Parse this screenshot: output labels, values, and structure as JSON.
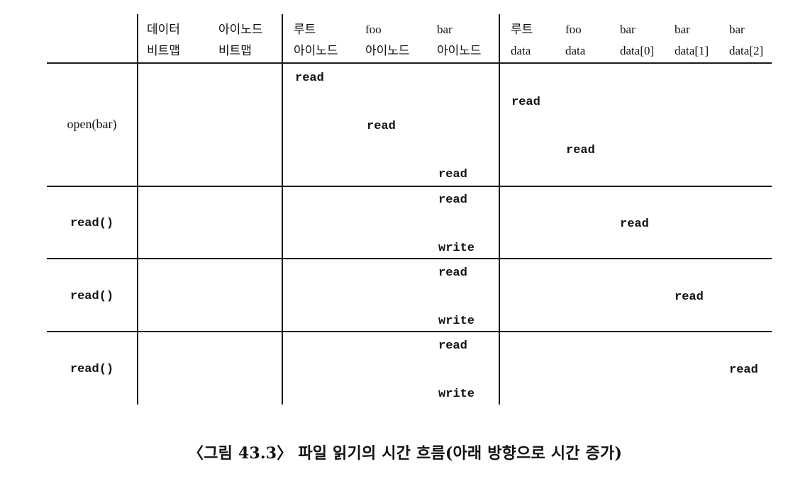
{
  "figure": {
    "caption": "〈그림 43.3〉 파일 읽기의 시간 흐름(아래 방향으로 시간 증가)"
  },
  "table": {
    "column_groups": [
      {
        "name": "operation",
        "columns": []
      },
      {
        "name": "bitmaps",
        "columns": [
          {
            "id": "data_bitmap",
            "line1": "데이터",
            "line2": "비트맵"
          },
          {
            "id": "inode_bitmap",
            "line1": "아이노드",
            "line2": "비트맵"
          }
        ]
      },
      {
        "name": "inodes",
        "columns": [
          {
            "id": "root_inode",
            "line1": "루트",
            "line2": "아이노드"
          },
          {
            "id": "foo_inode",
            "line1": "foo",
            "line2": "아이노드"
          },
          {
            "id": "bar_inode",
            "line1": "bar",
            "line2": "아이노드"
          }
        ]
      },
      {
        "name": "data_blocks",
        "columns": [
          {
            "id": "root_data",
            "line1": "루트",
            "line2": "data"
          },
          {
            "id": "foo_data",
            "line1": "foo",
            "line2": "data"
          },
          {
            "id": "bar_data0",
            "line1": "bar",
            "line2": "data[0]"
          },
          {
            "id": "bar_data1",
            "line1": "bar",
            "line2": "data[1]"
          },
          {
            "id": "bar_data2",
            "line1": "bar",
            "line2": "data[2]"
          }
        ]
      }
    ],
    "rows": [
      {
        "id": "row-open-bar",
        "label": "open(bar)",
        "label_style": "serif",
        "operations": [
          {
            "column": "root_inode",
            "op": "read"
          },
          {
            "column": "root_data",
            "op": "read"
          },
          {
            "column": "foo_inode",
            "op": "read"
          },
          {
            "column": "foo_data",
            "op": "read"
          },
          {
            "column": "bar_inode",
            "op": "read"
          }
        ]
      },
      {
        "id": "row-read-1",
        "label": "read()",
        "label_style": "mono",
        "operations": [
          {
            "column": "bar_inode",
            "op": "read"
          },
          {
            "column": "bar_data0",
            "op": "read"
          },
          {
            "column": "bar_inode",
            "op": "write"
          }
        ]
      },
      {
        "id": "row-read-2",
        "label": "read()",
        "label_style": "mono",
        "operations": [
          {
            "column": "bar_inode",
            "op": "read"
          },
          {
            "column": "bar_data1",
            "op": "read"
          },
          {
            "column": "bar_inode",
            "op": "write"
          }
        ]
      },
      {
        "id": "row-read-3",
        "label": "read()",
        "label_style": "mono",
        "operations": [
          {
            "column": "bar_inode",
            "op": "read"
          },
          {
            "column": "bar_data2",
            "op": "read"
          },
          {
            "column": "bar_inode",
            "op": "write"
          }
        ]
      }
    ]
  },
  "cells": {
    "h1": {
      "text": "데이터",
      "text2": "비트맵"
    },
    "h2": {
      "text": "아이노드",
      "text2": "비트맵"
    },
    "h3": {
      "text": "루트",
      "text2": "아이노드"
    },
    "h4": {
      "text": "foo",
      "text2": "아이노드"
    },
    "h5": {
      "text": "bar",
      "text2": "아이노드"
    },
    "h6": {
      "text": "루트",
      "text2": "data"
    },
    "h7": {
      "text": "foo",
      "text2": "data"
    },
    "h8": {
      "text": "bar",
      "text2": "data[0]"
    },
    "h9": {
      "text": "bar",
      "text2": "data[1]"
    },
    "h10": {
      "text": "bar",
      "text2": "data[2]"
    },
    "r1_label": "open(bar)",
    "r1_op1": "read",
    "r1_op2": "read",
    "r1_op3": "read",
    "r1_op4": "read",
    "r1_op5": "read",
    "r2_label": "read()",
    "r2_op1": "read",
    "r2_op2": "read",
    "r2_op3": "write",
    "r3_label": "read()",
    "r3_op1": "read",
    "r3_op2": "read",
    "r3_op3": "write",
    "r4_label": "read()",
    "r4_op1": "read",
    "r4_op2": "read",
    "r4_op3": "write"
  },
  "colors": {
    "ink": "#111111",
    "rule": "#1a1a1a",
    "background": "#ffffff"
  }
}
